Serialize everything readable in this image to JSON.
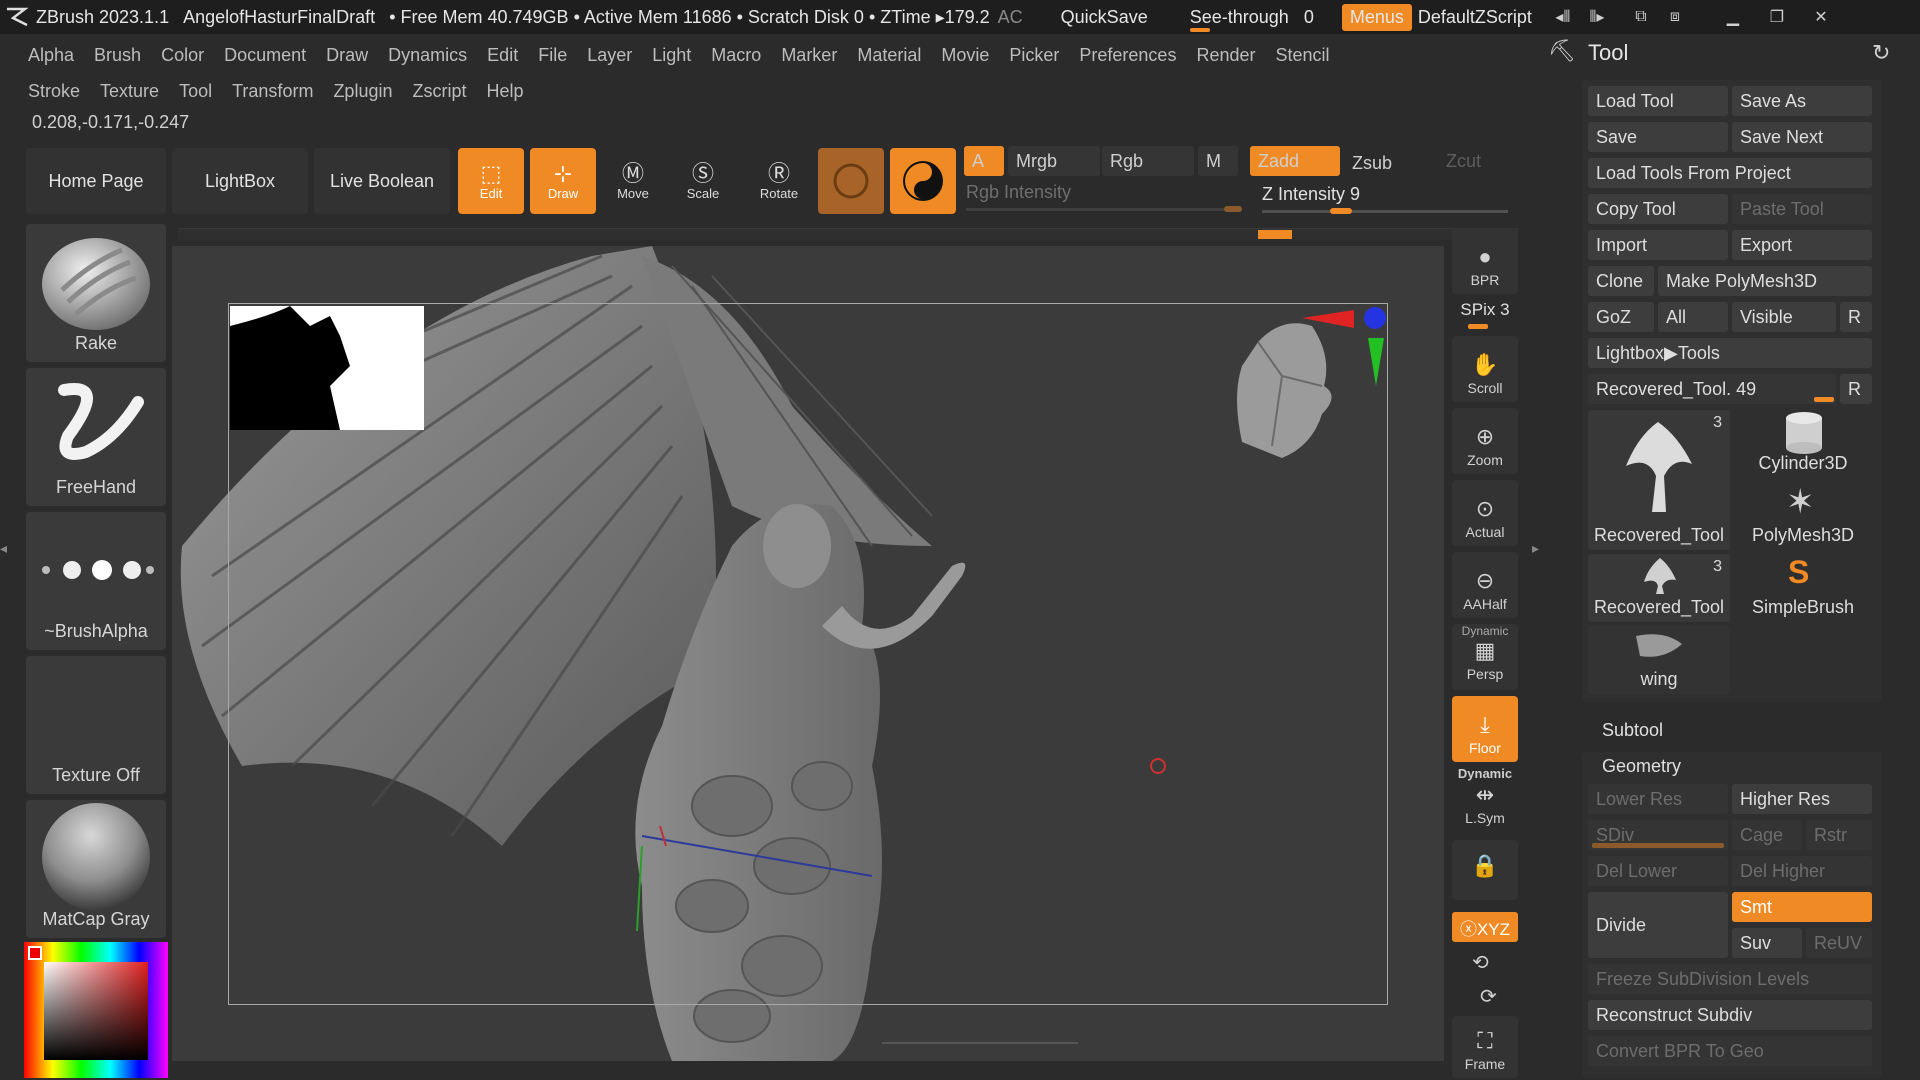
{
  "titlebar": {
    "app": "ZBrush 2023.1.1",
    "document": "AngelofHasturFinalDraft",
    "memory": "• Free Mem 40.749GB • Active Mem 11686 • Scratch Disk 0 • ZTime ▸179.2",
    "ac": "AC",
    "quicksave": "QuickSave",
    "seethrough_label": "See-through",
    "seethrough_value": "0",
    "menus": "Menus",
    "script": "DefaultZScript"
  },
  "menus_row1": [
    "Alpha",
    "Brush",
    "Color",
    "Document",
    "Draw",
    "Dynamics",
    "Edit",
    "File",
    "Layer",
    "Light",
    "Macro",
    "Marker",
    "Material",
    "Movie",
    "Picker",
    "Preferences",
    "Render",
    "Stencil"
  ],
  "menus_row2": [
    "Stroke",
    "Texture",
    "Tool",
    "Transform",
    "Zplugin",
    "Zscript",
    "Help"
  ],
  "coords": "0.208,-0.171,-0.247",
  "toolbar": {
    "home": "Home Page",
    "lightbox": "LightBox",
    "liveboolean": "Live Boolean",
    "edit": "Edit",
    "draw": "Draw",
    "move": "Move",
    "scale": "Scale",
    "rotate": "Rotate",
    "a": "A",
    "mrgb": "Mrgb",
    "rgb": "Rgb",
    "m": "M",
    "zadd": "Zadd",
    "zsub": "Zsub",
    "zcut": "Zcut",
    "rgb_intensity": "Rgb Intensity",
    "z_intensity": "Z Intensity 9"
  },
  "shelf": {
    "brush": "Rake",
    "stroke": "FreeHand",
    "alpha": "~BrushAlpha",
    "texture": "Texture Off",
    "material": "MatCap Gray"
  },
  "vstrip": {
    "bpr": "BPR",
    "spix": "SPix 3",
    "scroll": "Scroll",
    "zoom": "Zoom",
    "actual": "Actual",
    "aahalf": "AAHalf",
    "dynamic1": "Dynamic",
    "persp": "Persp",
    "floor": "Floor",
    "dynamic2": "Dynamic",
    "lsym": "L.Sym",
    "xyz": "ⓧXYZ",
    "frame": "Frame"
  },
  "toolpanel": {
    "title": "Tool",
    "load_tool": "Load Tool",
    "save_as": "Save As",
    "save": "Save",
    "save_next": "Save Next",
    "load_from_project": "Load Tools From Project",
    "copy_tool": "Copy Tool",
    "paste_tool": "Paste Tool",
    "import": "Import",
    "export": "Export",
    "clone": "Clone",
    "make_polymesh": "Make PolyMesh3D",
    "goz": "GoZ",
    "all": "All",
    "visible": "Visible",
    "r": "R",
    "lightbox_tools": "Lightbox▶Tools",
    "recovered_slider": "Recovered_Tool. 49",
    "tools": [
      {
        "name": "Recovered_Tool",
        "count": "3"
      },
      {
        "name": "Cylinder3D"
      },
      {
        "name": "PolyMesh3D"
      },
      {
        "name": "Recovered_Tool",
        "count": "3"
      },
      {
        "name": "SimpleBrush"
      },
      {
        "name": "wing"
      }
    ],
    "subtool": "Subtool",
    "geometry": "Geometry",
    "lower_res": "Lower Res",
    "higher_res": "Higher Res",
    "sdiv": "SDiv",
    "cage": "Cage",
    "rstr": "Rstr",
    "del_lower": "Del Lower",
    "del_higher": "Del Higher",
    "divide": "Divide",
    "smt": "Smt",
    "suv": "Suv",
    "reuv": "ReUV",
    "freeze": "Freeze SubDivision Levels",
    "reconstruct": "Reconstruct Subdiv",
    "convert_bpr": "Convert BPR To Geo"
  },
  "colors": {
    "accent": "#f08a24",
    "background": "#2b2b2b",
    "viewport": "#3b3b3b"
  }
}
